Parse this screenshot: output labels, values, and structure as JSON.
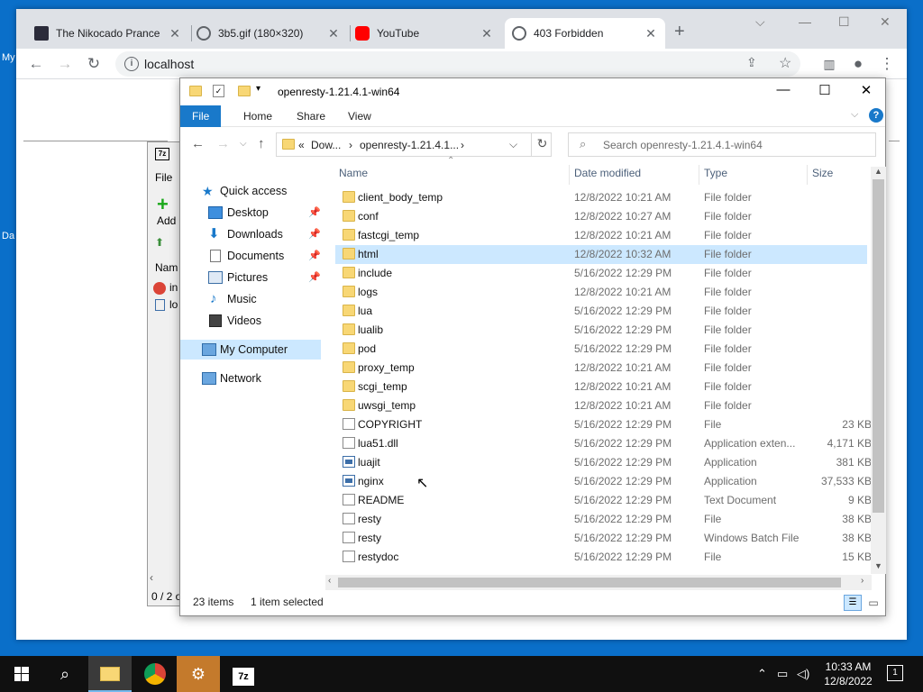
{
  "desktop": {
    "labels": [
      "My",
      "Da"
    ]
  },
  "chrome": {
    "tabs": [
      {
        "title": "The Nikocado Prance",
        "icon": "image-favicon"
      },
      {
        "title": "3b5.gif (180×320)",
        "icon": "globe-icon"
      },
      {
        "title": "YouTube",
        "icon": "youtube-icon"
      },
      {
        "title": "403 Forbidden",
        "icon": "globe-icon"
      }
    ],
    "url": "localhost"
  },
  "sevenzip": {
    "menu": "File",
    "add_label": "Add",
    "col_name": "Nam",
    "row1": "in",
    "row2": "lo",
    "status": "0 / 2 o"
  },
  "explorer": {
    "title": "openresty-1.21.4.1-win64",
    "ribbon_tabs": [
      "File",
      "Home",
      "Share",
      "View"
    ],
    "breadcrumb": [
      "«",
      "Dow...",
      "›",
      "openresty-1.21.4.1...",
      "›"
    ],
    "search_placeholder": "Search openresty-1.21.4.1-win64",
    "nav": [
      {
        "label": "Quick access",
        "icon": "star-icon"
      },
      {
        "label": "Desktop",
        "icon": "desktop-icon",
        "pinned": true
      },
      {
        "label": "Downloads",
        "icon": "download-icon",
        "pinned": true
      },
      {
        "label": "Documents",
        "icon": "documents-icon",
        "pinned": true
      },
      {
        "label": "Pictures",
        "icon": "pictures-icon",
        "pinned": true
      },
      {
        "label": "Music",
        "icon": "music-icon"
      },
      {
        "label": "Videos",
        "icon": "videos-icon"
      },
      {
        "label": "My Computer",
        "icon": "computer-icon",
        "selected": true
      },
      {
        "label": "Network",
        "icon": "network-icon"
      }
    ],
    "columns": [
      "Name",
      "Date modified",
      "Type",
      "Size"
    ],
    "files": [
      {
        "name": "client_body_temp",
        "date": "12/8/2022 10:21 AM",
        "type": "File folder",
        "size": "",
        "kind": "folder"
      },
      {
        "name": "conf",
        "date": "12/8/2022 10:27 AM",
        "type": "File folder",
        "size": "",
        "kind": "folder"
      },
      {
        "name": "fastcgi_temp",
        "date": "12/8/2022 10:21 AM",
        "type": "File folder",
        "size": "",
        "kind": "folder"
      },
      {
        "name": "html",
        "date": "12/8/2022 10:32 AM",
        "type": "File folder",
        "size": "",
        "kind": "folder",
        "selected": true
      },
      {
        "name": "include",
        "date": "5/16/2022 12:29 PM",
        "type": "File folder",
        "size": "",
        "kind": "folder"
      },
      {
        "name": "logs",
        "date": "12/8/2022 10:21 AM",
        "type": "File folder",
        "size": "",
        "kind": "folder"
      },
      {
        "name": "lua",
        "date": "5/16/2022 12:29 PM",
        "type": "File folder",
        "size": "",
        "kind": "folder"
      },
      {
        "name": "lualib",
        "date": "5/16/2022 12:29 PM",
        "type": "File folder",
        "size": "",
        "kind": "folder"
      },
      {
        "name": "pod",
        "date": "5/16/2022 12:29 PM",
        "type": "File folder",
        "size": "",
        "kind": "folder"
      },
      {
        "name": "proxy_temp",
        "date": "12/8/2022 10:21 AM",
        "type": "File folder",
        "size": "",
        "kind": "folder"
      },
      {
        "name": "scgi_temp",
        "date": "12/8/2022 10:21 AM",
        "type": "File folder",
        "size": "",
        "kind": "folder"
      },
      {
        "name": "uwsgi_temp",
        "date": "12/8/2022 10:21 AM",
        "type": "File folder",
        "size": "",
        "kind": "folder"
      },
      {
        "name": "COPYRIGHT",
        "date": "5/16/2022 12:29 PM",
        "type": "File",
        "size": "23 KB",
        "kind": "file"
      },
      {
        "name": "lua51.dll",
        "date": "5/16/2022 12:29 PM",
        "type": "Application exten...",
        "size": "4,171 KB",
        "kind": "file"
      },
      {
        "name": "luajit",
        "date": "5/16/2022 12:29 PM",
        "type": "Application",
        "size": "381 KB",
        "kind": "app"
      },
      {
        "name": "nginx",
        "date": "5/16/2022 12:29 PM",
        "type": "Application",
        "size": "37,533 KB",
        "kind": "app",
        "hover": true
      },
      {
        "name": "README",
        "date": "5/16/2022 12:29 PM",
        "type": "Text Document",
        "size": "9 KB",
        "kind": "file"
      },
      {
        "name": "resty",
        "date": "5/16/2022 12:29 PM",
        "type": "File",
        "size": "38 KB",
        "kind": "file"
      },
      {
        "name": "resty",
        "date": "5/16/2022 12:29 PM",
        "type": "Windows Batch File",
        "size": "38 KB",
        "kind": "file"
      },
      {
        "name": "restydoc",
        "date": "5/16/2022 12:29 PM",
        "type": "File",
        "size": "15 KB",
        "kind": "file"
      }
    ],
    "status_count": "23 items",
    "status_selected": "1 item selected"
  },
  "taskbar": {
    "time": "10:33 AM",
    "date": "12/8/2022",
    "notifications": "1"
  }
}
